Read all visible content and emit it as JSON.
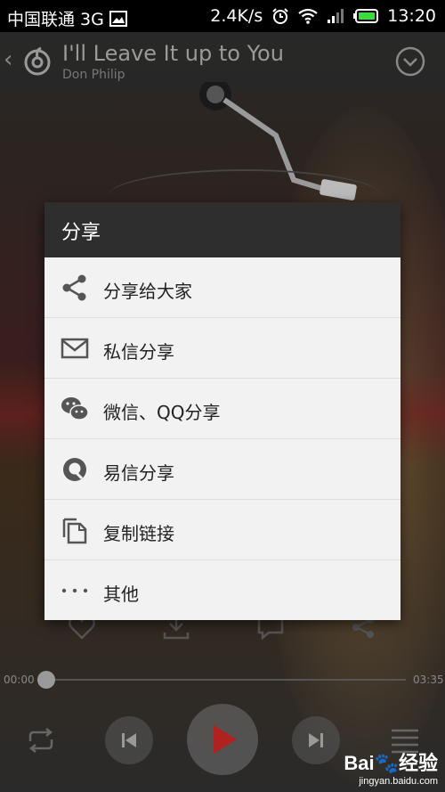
{
  "status_bar": {
    "carrier": "中国联通 3G",
    "speed": "2.4K/s",
    "time": "13:20"
  },
  "player": {
    "title": "I'll Leave It up to You",
    "artist": "Don Philip",
    "time_elapsed": "00:00",
    "time_total": "03:35"
  },
  "dialog": {
    "title": "分享",
    "items": [
      {
        "label": "分享给大家",
        "icon": "share-icon"
      },
      {
        "label": "私信分享",
        "icon": "mail-icon"
      },
      {
        "label": "微信、QQ分享",
        "icon": "wechat-icon"
      },
      {
        "label": "易信分享",
        "icon": "yixin-icon"
      },
      {
        "label": "复制链接",
        "icon": "copy-icon"
      },
      {
        "label": "其他",
        "icon": "more-icon"
      }
    ]
  },
  "watermark": {
    "brand": "Bai",
    "brand2": "经验",
    "domain": "jingyan.baidu.com"
  }
}
